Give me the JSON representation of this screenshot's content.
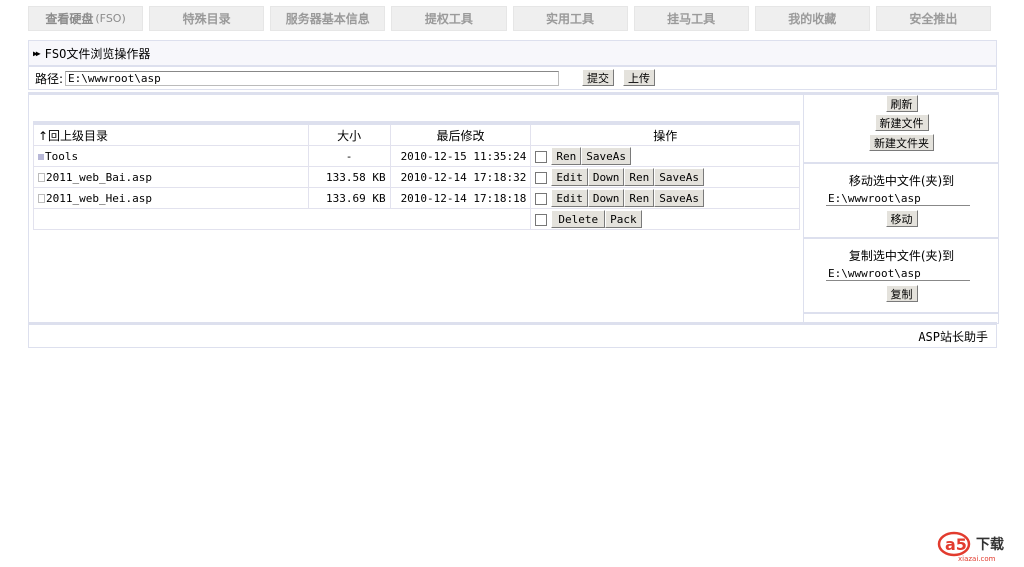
{
  "nav": {
    "tabs": [
      {
        "label": "查看硬盘",
        "sub": "(FSO)"
      },
      {
        "label": "特殊目录"
      },
      {
        "label": "服务器基本信息"
      },
      {
        "label": "提权工具"
      },
      {
        "label": "实用工具"
      },
      {
        "label": "挂马工具"
      },
      {
        "label": "我的收藏"
      },
      {
        "label": "安全推出"
      }
    ]
  },
  "panel": {
    "title": "FSO文件浏览操作器"
  },
  "path": {
    "label": "路径:",
    "value": "E:\\wwwroot\\asp",
    "submit_label": "提交",
    "upload_label": "上传"
  },
  "table": {
    "headers": {
      "name": "↑回上级目录",
      "size": "大小",
      "modified": "最后修改",
      "ops": "操作"
    },
    "rows": [
      {
        "name": "Tools",
        "size": "-",
        "modified": "2010-12-15 11:35:24",
        "buttons": [
          "Ren",
          "SaveAs"
        ]
      },
      {
        "name": "2011_web_Bai.asp",
        "size": "133.58 KB",
        "modified": "2010-12-14 17:18:32",
        "buttons": [
          "Edit",
          "Down",
          "Ren",
          "SaveAs"
        ]
      },
      {
        "name": "2011_web_Hei.asp",
        "size": "133.69 KB",
        "modified": "2010-12-14 17:18:18",
        "buttons": [
          "Edit",
          "Down",
          "Ren",
          "SaveAs"
        ]
      }
    ],
    "bulk": {
      "delete_label": "Delete",
      "pack_label": "Pack"
    }
  },
  "right": {
    "refresh_label": "刷新",
    "new_file_label": "新建文件",
    "new_folder_label": "新建文件夹",
    "move": {
      "title": "移动选中文件(夹)到",
      "value": "E:\\wwwroot\\asp",
      "button_label": "移动"
    },
    "copy": {
      "title": "复制选中文件(夹)到",
      "value": "E:\\wwwroot\\asp",
      "button_label": "复制"
    }
  },
  "footer": {
    "text": "ASP站长助手"
  },
  "logo": {
    "mark": "a5",
    "label": "下载",
    "site": "xiazai.com"
  }
}
